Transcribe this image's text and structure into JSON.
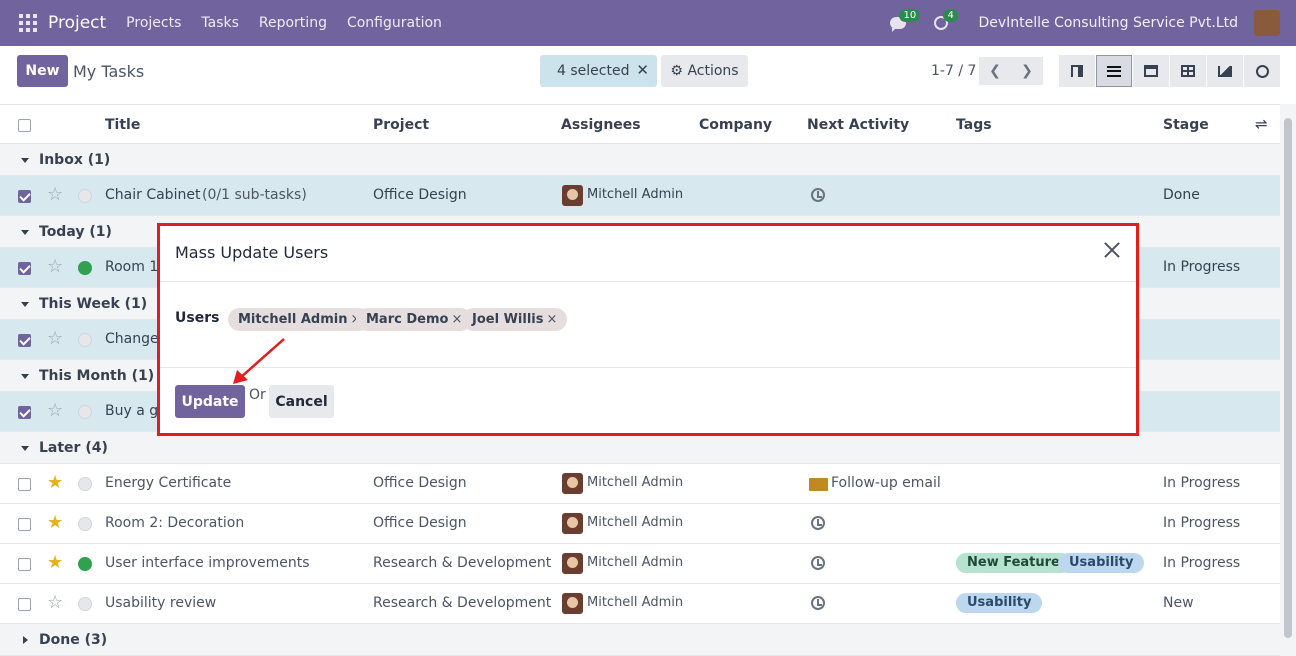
{
  "nav": {
    "app": "Project",
    "menus": [
      "Projects",
      "Tasks",
      "Reporting",
      "Configuration"
    ],
    "chat_badge": "10",
    "activity_badge": "4",
    "company": "DevIntelle Consulting Service Pvt.Ltd"
  },
  "control": {
    "new_label": "New",
    "breadcrumb": "My Tasks",
    "selected": "4 selected",
    "actions_label": "Actions",
    "pager": "1-7 / 7"
  },
  "columns": {
    "title": "Title",
    "project": "Project",
    "assignees": "Assignees",
    "company": "Company",
    "next_activity": "Next Activity",
    "tags": "Tags",
    "stage": "Stage"
  },
  "groups": {
    "inbox": "Inbox (1)",
    "today": "Today (1)",
    "this_week": "This Week (1)",
    "this_month": "This Month (1)",
    "later": "Later (4)",
    "done": "Done (3)"
  },
  "rows": {
    "r1": {
      "title": "Chair Cabinet",
      "subtasks": "(0/1 sub-tasks)",
      "project": "Office Design",
      "assignee": "Mitchell Admin",
      "stage": "Done"
    },
    "r2": {
      "title": "Room 1:",
      "stage": "In Progress"
    },
    "r3": {
      "title": "Change"
    },
    "r4": {
      "title": "Buy a gi"
    },
    "r5": {
      "title": "Energy Certificate",
      "project": "Office Design",
      "assignee": "Mitchell Admin",
      "activity": "Follow-up email",
      "stage": "In Progress"
    },
    "r6": {
      "title": "Room 2: Decoration",
      "project": "Office Design",
      "assignee": "Mitchell Admin",
      "stage": "In Progress"
    },
    "r7": {
      "title": "User interface improvements",
      "project": "Research & Development",
      "assignee": "Mitchell Admin",
      "tag1": "New Feature",
      "tag2": "Usability",
      "stage": "In Progress"
    },
    "r8": {
      "title": "Usability review",
      "project": "Research & Development",
      "assignee": "Mitchell Admin",
      "tag1": "Usability",
      "stage": "New"
    }
  },
  "modal": {
    "title": "Mass Update Users",
    "users_label": "Users",
    "chips": [
      "Mitchell Admin",
      "Marc Demo",
      "Joel Willis"
    ],
    "chip_remove": "×",
    "update_label": "Update",
    "or_label": "Or",
    "cancel_label": "Cancel"
  },
  "colors": {
    "brand": "#71639e",
    "highlight": "#e11d1d",
    "selected_row": "#d8e8ef"
  }
}
